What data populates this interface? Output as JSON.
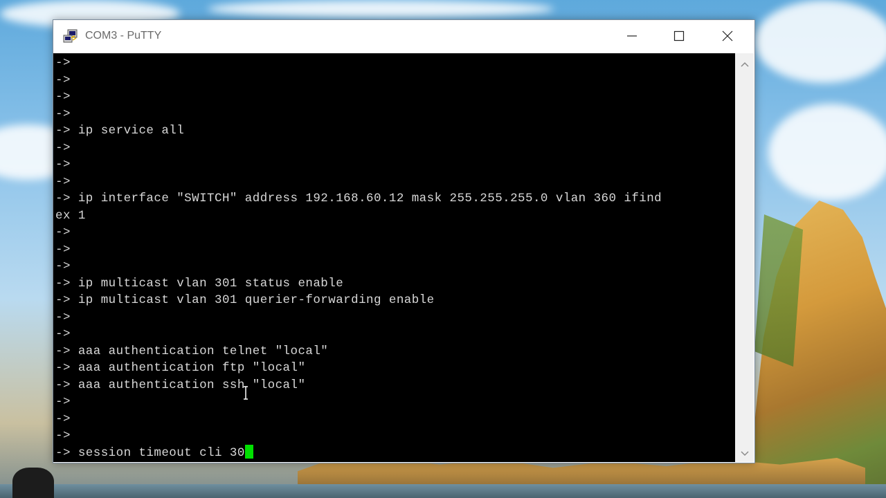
{
  "window": {
    "title": "COM3 - PuTTY",
    "icon": "putty-icon"
  },
  "controls": {
    "minimize_icon": "minimize-icon",
    "maximize_icon": "maximize-icon",
    "close_icon": "close-icon"
  },
  "terminal": {
    "background": "#000000",
    "text_color": "#d8d8d8",
    "cursor_color": "#00e000",
    "lines": [
      "->",
      "->",
      "->",
      "->",
      "-> ip service all",
      "->",
      "->",
      "->",
      "-> ip interface \"SWITCH\" address 192.168.60.12 mask 255.255.255.0 vlan 360 ifind",
      "ex 1",
      "->",
      "->",
      "->",
      "-> ip multicast vlan 301 status enable",
      "-> ip multicast vlan 301 querier-forwarding enable",
      "->",
      "->",
      "-> aaa authentication telnet \"local\"",
      "-> aaa authentication ftp \"local\"",
      "-> aaa authentication ssh \"local\"",
      "->",
      "->",
      "->"
    ],
    "current_line": "-> session timeout cli 30"
  },
  "scrollbar": {
    "up_icon": "chevron-up-icon",
    "down_icon": "chevron-down-icon"
  }
}
